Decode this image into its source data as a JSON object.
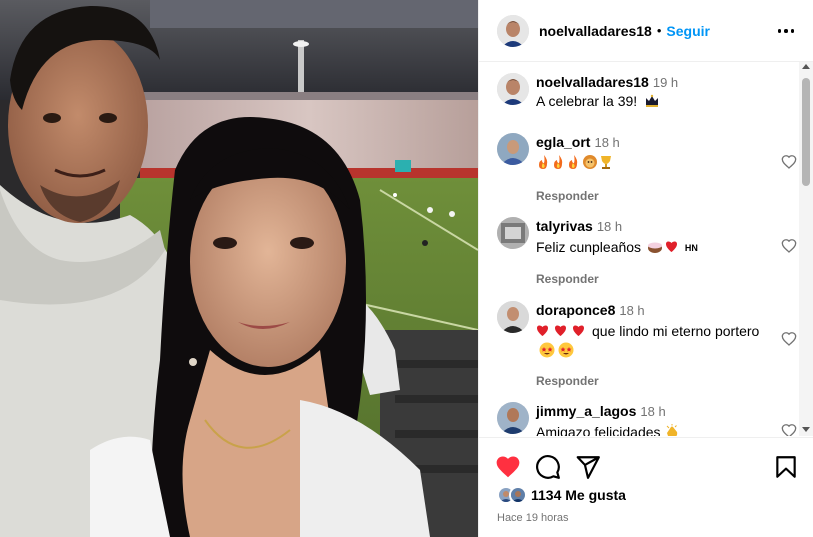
{
  "post": {
    "username": "noelvalladares18",
    "separator": "•",
    "follow_label": "Seguir"
  },
  "caption": {
    "username": "noelvalladares18",
    "time": "19 h",
    "text": "A celebrar la 39!"
  },
  "comments": [
    {
      "username": "egla_ort",
      "time": "18 h",
      "text": "",
      "emojis": [
        "fire",
        "fire",
        "fire",
        "lion",
        "trophy"
      ],
      "reply_label": "Responder"
    },
    {
      "username": "talyrivas",
      "time": "18 h",
      "text": "Feliz cunpleaños",
      "suffix_text": "HN",
      "emojis": [
        "cake",
        "red-heart"
      ],
      "reply_label": "Responder"
    },
    {
      "username": "doraponce8",
      "time": "18 h",
      "text": "que lindo mi eterno portero",
      "emojis": [
        "red-heart",
        "red-heart",
        "red-heart"
      ],
      "trailing_emojis": [
        "star-struck",
        "star-struck"
      ],
      "reply_label": "Responder"
    },
    {
      "username": "jimmy_a_lagos",
      "time": "18 h",
      "text": "Amigazo felicidades",
      "emojis": [
        "clapping-hands"
      ]
    }
  ],
  "likes": {
    "count_label": "1134 Me gusta"
  },
  "posted_ago": "Hace 19 horas",
  "colors": {
    "accent": "#0095f6",
    "like_red": "#ff3040",
    "muted": "#737373"
  }
}
